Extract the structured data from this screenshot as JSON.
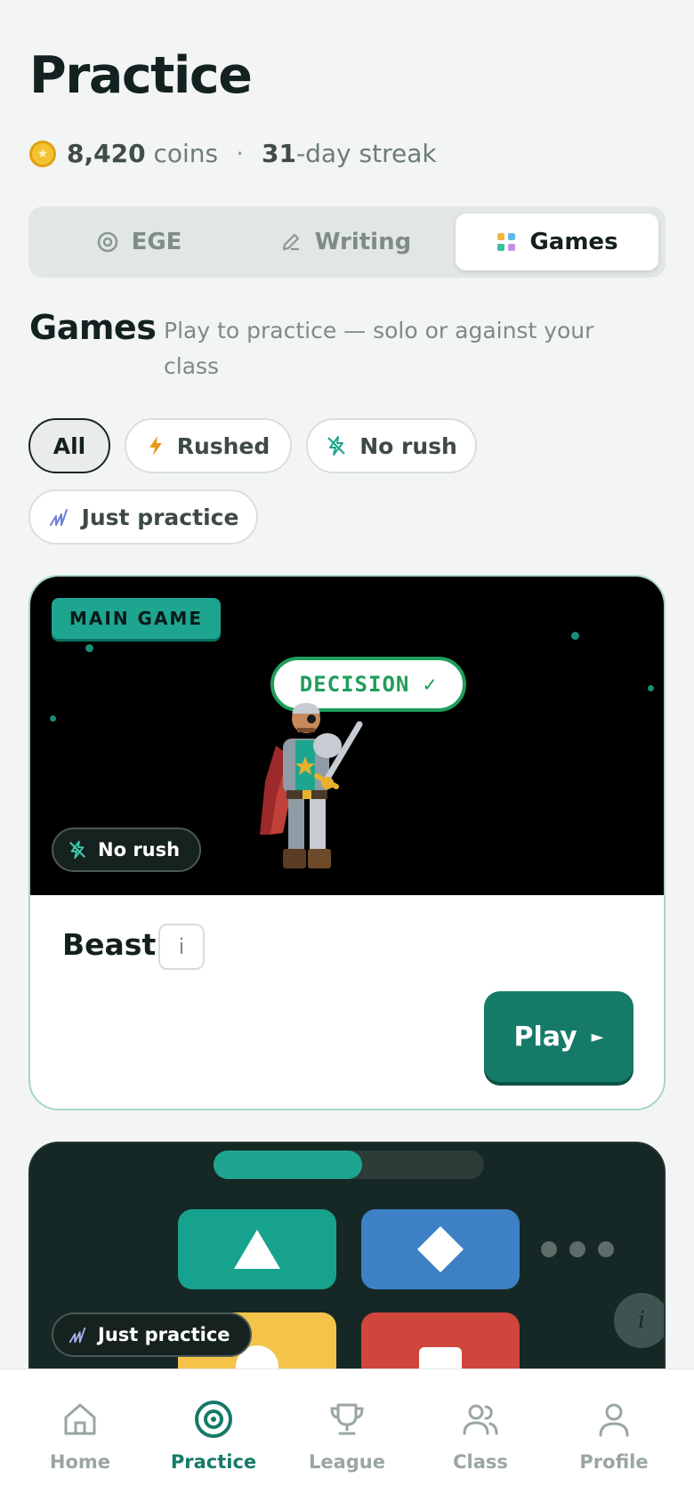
{
  "header": {
    "title": "Practice"
  },
  "stats": {
    "coins_value": "8,420",
    "coins_label": "coins",
    "separator": "·",
    "streak_value": "31",
    "streak_label": "-day streak"
  },
  "segments": [
    {
      "label": "EGE",
      "icon": "target-icon",
      "selected": false
    },
    {
      "label": "Writing",
      "icon": "pencil-icon",
      "selected": false
    },
    {
      "label": "Games",
      "icon": "dots-grid-icon",
      "selected": true
    }
  ],
  "section": {
    "title": "Games",
    "subtitle": "Play to practice — solo or against your class"
  },
  "filters": [
    {
      "label": "All",
      "icon": null,
      "selected": true
    },
    {
      "label": "Rushed",
      "icon": "lightning-icon",
      "selected": false
    },
    {
      "label": "No rush",
      "icon": "lightning-off-icon",
      "selected": false
    },
    {
      "label": "Just practice",
      "icon": "practice-chart-icon",
      "selected": false
    }
  ],
  "games": [
    {
      "badge": "MAIN GAME",
      "callout": "DECISION ✓",
      "mode": "No rush",
      "name": "Beast",
      "info": "i",
      "play_label": "Play",
      "play_arrow": "►"
    },
    {
      "mode": "Just practice",
      "progress": 0.55,
      "info": "i"
    }
  ],
  "colors": {
    "accent": "#157a68",
    "teal": "#1ea58f",
    "blue": "#3d80c6",
    "yellow": "#f4c34a",
    "red": "#d0463c"
  },
  "tabbar": [
    {
      "label": "Home",
      "icon": "home-icon",
      "active": false
    },
    {
      "label": "Practice",
      "icon": "target-icon",
      "active": true
    },
    {
      "label": "League",
      "icon": "trophy-icon",
      "active": false
    },
    {
      "label": "Class",
      "icon": "users-icon",
      "active": false
    },
    {
      "label": "Profile",
      "icon": "user-icon",
      "active": false
    }
  ]
}
